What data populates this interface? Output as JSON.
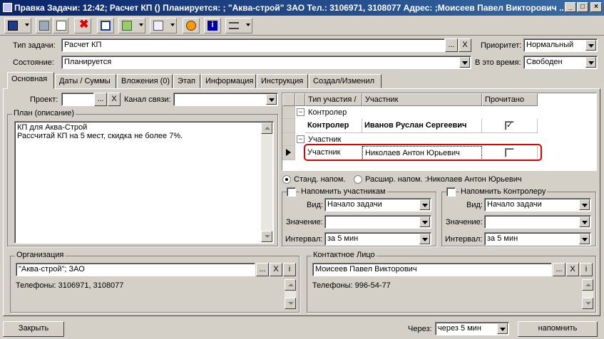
{
  "window": {
    "title": "Правка Задачи: 12:42; Расчет КП () Планируется: ; \"Аква-строй\" ЗАО Тел.: 3106971, 3108077 Адрес: ;Моисеев Павел Викторович ...",
    "minimize": "_",
    "maximize": "□",
    "close": "×"
  },
  "header": {
    "task_type_label": "Тип задачи:",
    "task_type_value": "Расчет КП",
    "priority_label": "Приоритет:",
    "priority_value": "Нормальный",
    "state_label": "Состояние:",
    "state_value": "Планируется",
    "at_time_label": "В это время:",
    "at_time_value": "Свободен",
    "dots": "...",
    "clear": "X"
  },
  "tabs": [
    "Основная",
    "Даты / Суммы",
    "Вложения (0)",
    "Этап",
    "Информация",
    "Инструкция",
    "Создал/Изменил"
  ],
  "main": {
    "project_label": "Проект:",
    "channel_label": "Канал связи:",
    "plan_label": "План (описание)",
    "plan_line1": "КП для Аква-Строй",
    "plan_line2": "Рассчитай КП на  5 мест, скидка не более 7%."
  },
  "grid": {
    "headers": [
      "Тип участия",
      "Участник",
      "Прочитано"
    ],
    "group1": "Контролер",
    "row1": {
      "type": "Контролер",
      "name": "Иванов Руслан Сергеевич",
      "read": true
    },
    "group2": "Участник",
    "row2": {
      "type": "Участник",
      "name": "Николаев Антон Юрьевич",
      "read": false
    },
    "collapse": "−"
  },
  "remind": {
    "std": "Станд.  напом.",
    "ext": "Расшир. напом. :Николаев Антон Юрьевич",
    "left_title": "Напомнить участникам",
    "right_title": "Напомнить Контролеру",
    "kind_label": "Вид:",
    "kind_value": "Начало задачи",
    "value_label": "Значение:",
    "interval_label": "Интервал:",
    "interval_value": "за 5 мин"
  },
  "org": {
    "title": "Организация",
    "value": "\"Аква-строй\"; ЗАО",
    "phones": "Телефоны: 3106971, 3108077",
    "info": "i"
  },
  "contact": {
    "title": "Контактное Лицо",
    "value": "Моисеев Павел Викторович",
    "phones": "Телефоны: 996-54-77",
    "info": "i"
  },
  "footer": {
    "close": "Закрыть",
    "through_label": "Через:",
    "through_value": "через 5 мин",
    "remind": "напомнить"
  },
  "colors": {
    "title_start": "#0a246a",
    "title_end": "#3a6ea5",
    "highlight": "#e00000",
    "face": "#d4d0c8"
  }
}
